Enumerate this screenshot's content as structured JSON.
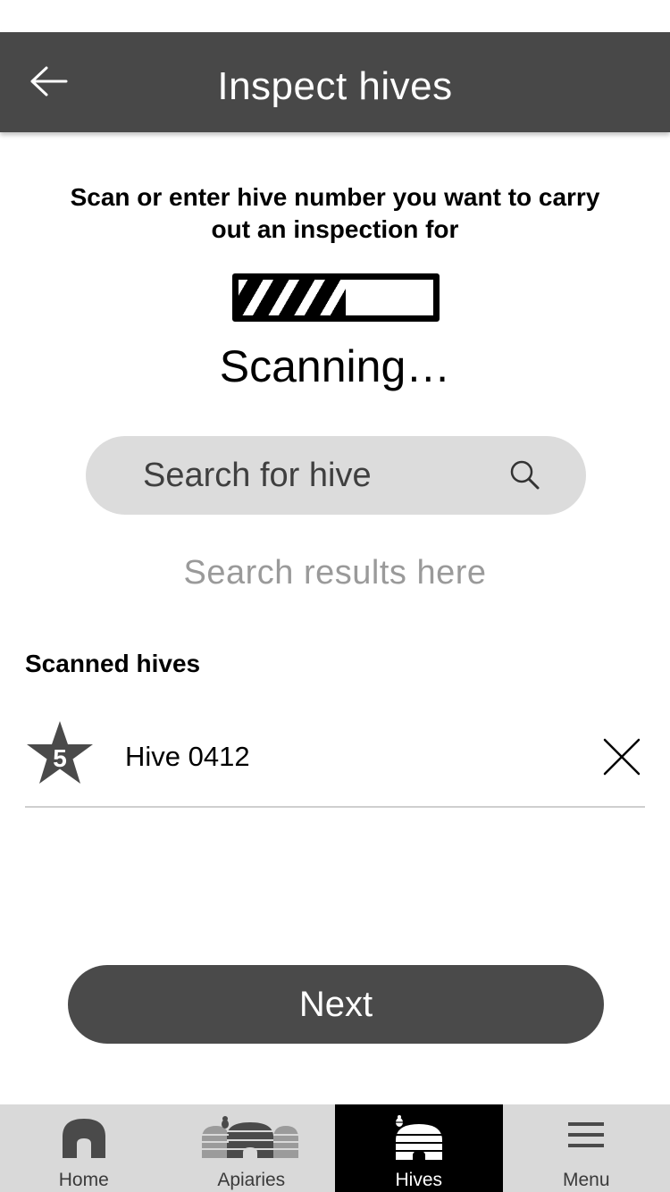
{
  "header": {
    "title": "Inspect hives",
    "back_icon": "arrow-left-icon"
  },
  "scan": {
    "instructions": "Scan or enter hive number you want to carry out an inspection for",
    "progress": 0.55,
    "status": "Scanning…"
  },
  "search": {
    "placeholder": "Search for hive",
    "icon": "search-icon",
    "results_placeholder": "Search results here"
  },
  "scanned": {
    "heading": "Scanned hives",
    "items": [
      {
        "rating": "5",
        "name": "Hive 0412",
        "remove_icon": "close-icon"
      }
    ]
  },
  "actions": {
    "next_label": "Next"
  },
  "tabbar": {
    "active": "Hives",
    "tabs": [
      {
        "label": "Home",
        "icon": "home-icon"
      },
      {
        "label": "Apiaries",
        "icon": "apiaries-icon"
      },
      {
        "label": "Hives",
        "icon": "beehive-icon"
      },
      {
        "label": "Menu",
        "icon": "hamburger-menu-icon"
      }
    ]
  },
  "colors": {
    "header_bg": "#484848",
    "button_bg": "#4a4a4a",
    "search_bg": "#dcdcdc",
    "tabbar_bg": "#d9d9d9",
    "active_tab_bg": "#000000",
    "muted_text": "#9a9a9a"
  }
}
